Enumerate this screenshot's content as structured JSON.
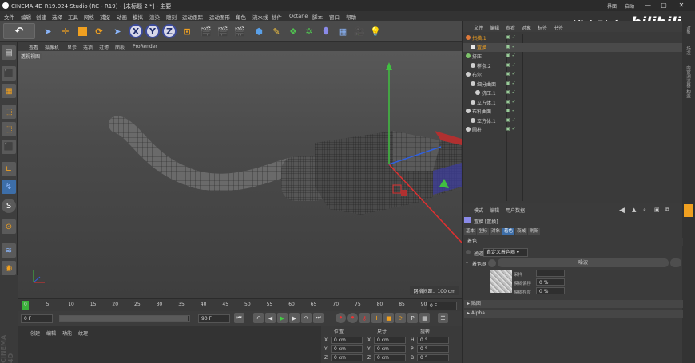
{
  "titlebar": {
    "title": "CINEMA 4D R19.024 Studio (RC - R19) - [未标题 2 *] - 主要",
    "minimize": "—",
    "maximize": "▢",
    "close": "✕",
    "layout_label": "界面",
    "layout_value": "启动"
  },
  "menubar": [
    "文件",
    "编辑",
    "创建",
    "选择",
    "工具",
    "网格",
    "捕捉",
    "动画",
    "模拟",
    "渲染",
    "雕刻",
    "运动跟踪",
    "运动图形",
    "角色",
    "流水线",
    "插件",
    "Octane",
    "脚本",
    "窗口",
    "帮助"
  ],
  "toolbar": {
    "undo": "↶",
    "x_label": "X",
    "y_label": "Y",
    "z_label": "Z"
  },
  "viewport": {
    "menu": [
      "查看",
      "摄像机",
      "显示",
      "选项",
      "过滤",
      "面板",
      "ProRender"
    ],
    "label": "透视视图",
    "grid_distance": "网格间距：100 cm"
  },
  "timeline": {
    "ticks": [
      "0",
      "5",
      "10",
      "15",
      "20",
      "25",
      "30",
      "35",
      "40",
      "45",
      "50",
      "55",
      "60",
      "65",
      "70",
      "75",
      "80",
      "85",
      "90"
    ],
    "frame": "0 F"
  },
  "transport": {
    "start": "0 F",
    "current": "0 F",
    "end": "90 F",
    "max": "90 F"
  },
  "materials": {
    "menu": [
      "创建",
      "编辑",
      "功能",
      "纹理"
    ]
  },
  "coords": {
    "headers": [
      "位置",
      "尺寸",
      "旋转"
    ],
    "rows": [
      [
        "X",
        "0 cm",
        "X",
        "0 cm",
        "H",
        "0 °"
      ],
      [
        "Y",
        "0 cm",
        "Y",
        "0 cm",
        "P",
        "0 °"
      ],
      [
        "Z",
        "0 cm",
        "Z",
        "0 cm",
        "B",
        "0 °"
      ]
    ]
  },
  "objects": {
    "menu": [
      "文件",
      "编辑",
      "查看",
      "对象",
      "标签",
      "书签"
    ],
    "rows": [
      {
        "name": "扫描.1",
        "color": "#e07a3a",
        "indent": 0,
        "selected": false
      },
      {
        "name": "置换",
        "color": "#e8e8e8",
        "indent": 1,
        "selected": true
      },
      {
        "name": "挤压",
        "color": "#7ec46a",
        "indent": 0,
        "selected": false
      },
      {
        "name": "样条.2",
        "color": "#cfcfcf",
        "indent": 1,
        "selected": false
      },
      {
        "name": "布尔",
        "color": "#cfcfcf",
        "indent": 0,
        "selected": false
      },
      {
        "name": "细分曲面",
        "color": "#cfcfcf",
        "indent": 1,
        "selected": false
      },
      {
        "name": "挤压.1",
        "color": "#cfcfcf",
        "indent": 2,
        "selected": false
      },
      {
        "name": "立方体.1",
        "color": "#cfcfcf",
        "indent": 1,
        "selected": false
      },
      {
        "name": "布料曲面",
        "color": "#cfcfcf",
        "indent": 0,
        "selected": false
      },
      {
        "name": "立方体.1",
        "color": "#cfcfcf",
        "indent": 1,
        "selected": false
      },
      {
        "name": "圆柱",
        "color": "#cfcfcf",
        "indent": 0,
        "selected": false
      }
    ]
  },
  "attributes": {
    "menu": [
      "模式",
      "编辑",
      "用户数据"
    ],
    "object_title": "置换 [置换]",
    "tabs": [
      "基本",
      "坐标",
      "对象",
      "着色",
      "衰减",
      "刷新"
    ],
    "active_tab": "着色",
    "section": "着色",
    "channel_label": "通道",
    "channel_value": "自定义着色器",
    "shader_label": "着色器",
    "shader_value": "噪波",
    "sample_label": "采样",
    "sample_value": "",
    "blur_offset_label": "模糊偏移",
    "blur_offset_value": "0 %",
    "blur_scale_label": "模糊程度",
    "blur_scale_value": "0 %",
    "sub1": "贴图",
    "sub2": "Alpha"
  },
  "watermark": {
    "cn": "不错实验室",
    "logo": "bilibili"
  },
  "sidebar": [
    "对象",
    "场次",
    "内容浏览器",
    "构造"
  ]
}
